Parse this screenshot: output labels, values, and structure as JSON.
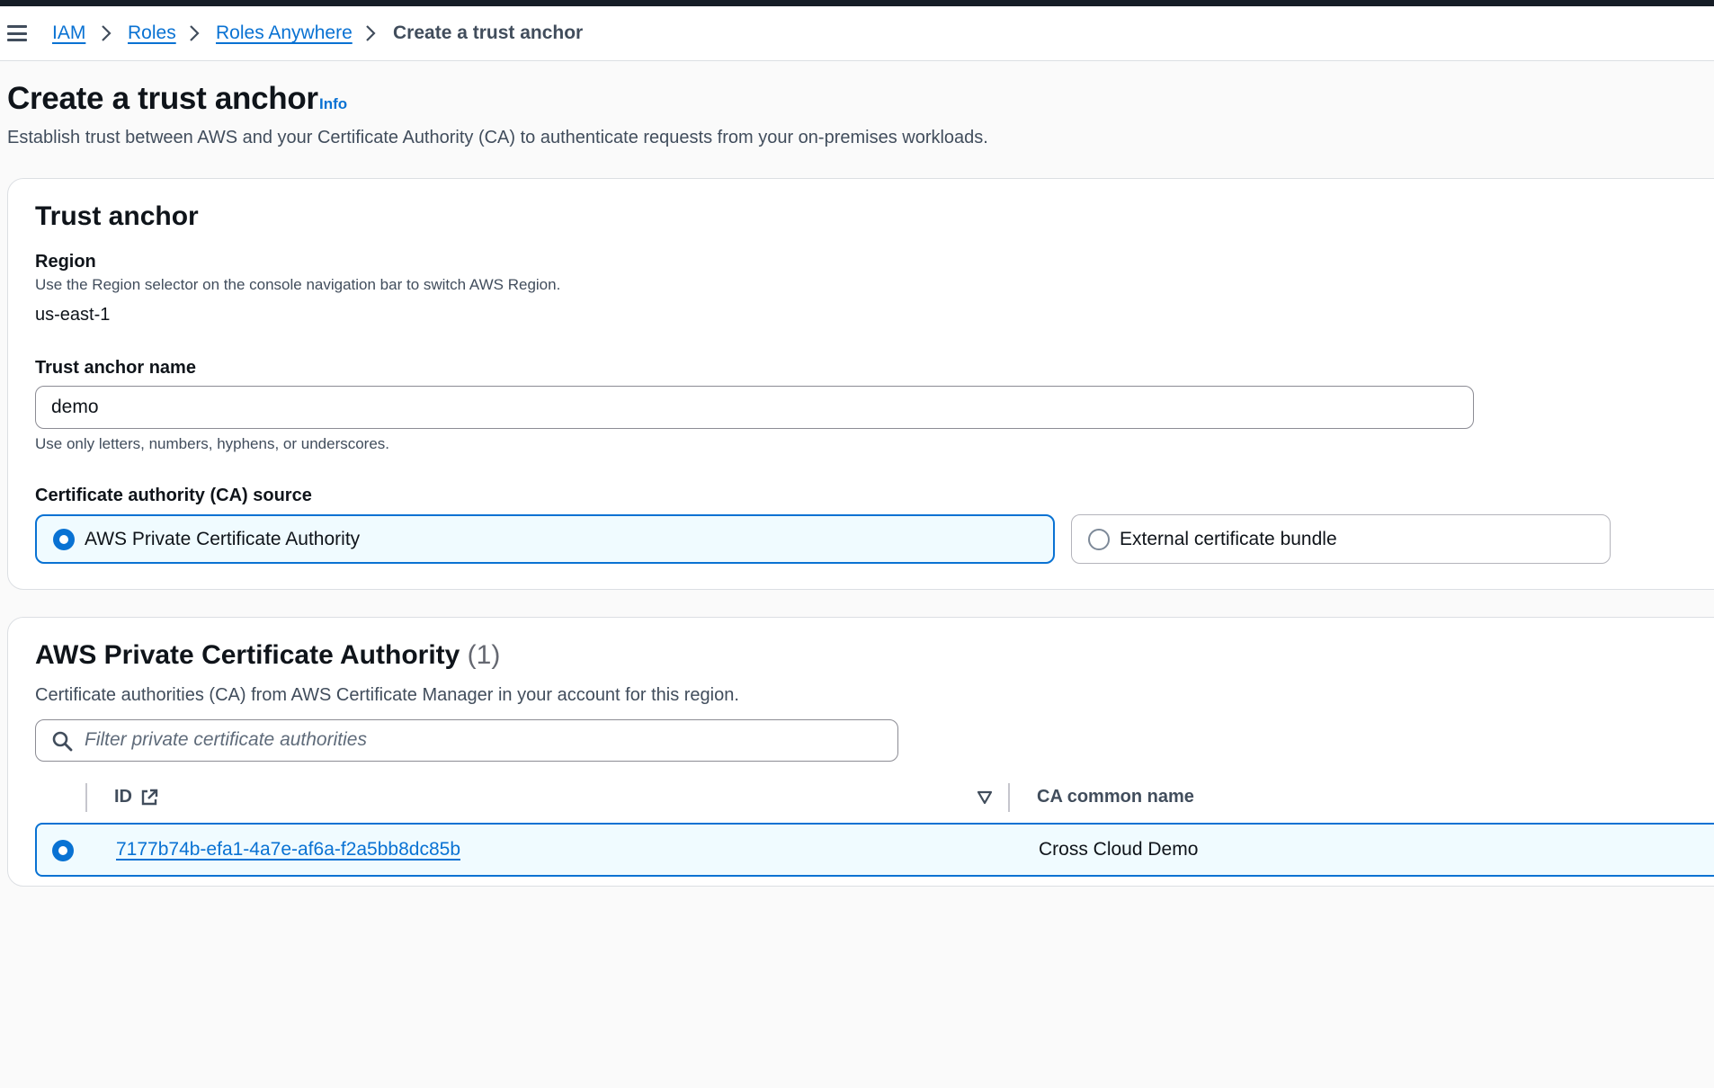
{
  "breadcrumb": {
    "items": [
      "IAM",
      "Roles",
      "Roles Anywhere"
    ],
    "current": "Create a trust anchor"
  },
  "page": {
    "title": "Create a trust anchor",
    "info": "Info",
    "description": "Establish trust between AWS and your Certificate Authority (CA) to authenticate requests from your on-premises workloads."
  },
  "trust_anchor": {
    "title": "Trust anchor",
    "region_label": "Region",
    "region_hint": "Use the Region selector on the console navigation bar to switch AWS Region.",
    "region_value": "us-east-1",
    "name_label": "Trust anchor name",
    "name_value": "demo",
    "name_hint": "Use only letters, numbers, hyphens, or underscores.",
    "ca_source_label": "Certificate authority (CA) source",
    "ca_options": [
      "AWS Private Certificate Authority",
      "External certificate bundle"
    ],
    "ca_selected": "AWS Private Certificate Authority"
  },
  "private_ca": {
    "title": "AWS Private Certificate Authority",
    "count": "(1)",
    "description": "Certificate authorities (CA) from AWS Certificate Manager in your account for this region.",
    "filter_placeholder": "Filter private certificate authorities",
    "columns": [
      "ID",
      "CA common name"
    ],
    "rows": [
      {
        "id": "7177b74b-efa1-4a7e-af6a-f2a5bb8dc85b",
        "common_name": "Cross Cloud Demo",
        "selected": true
      }
    ]
  },
  "colors": {
    "accent": "#0972d3",
    "selected_bg": "#f0fbff",
    "text": "#0f141a",
    "muted": "#414d5c"
  },
  "icons": [
    "menu-icon",
    "chevron-right-icon",
    "search-icon",
    "external-link-icon",
    "sort-down-icon"
  ]
}
